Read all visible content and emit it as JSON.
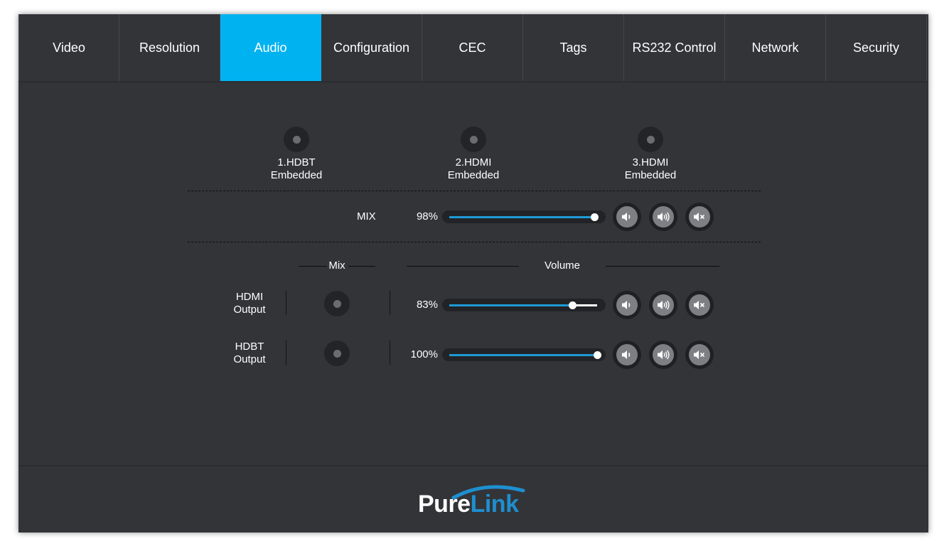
{
  "tabs": [
    {
      "label": "Video"
    },
    {
      "label": "Resolution"
    },
    {
      "label": "Audio"
    },
    {
      "label": "Configuration"
    },
    {
      "label": "CEC"
    },
    {
      "label": "Tags"
    },
    {
      "label": "RS232 Control"
    },
    {
      "label": "Network"
    },
    {
      "label": "Security"
    }
  ],
  "active_tab": "Audio",
  "accent_color": "#00b2f0",
  "sources": [
    {
      "label": "1.HDBT\nEmbedded"
    },
    {
      "label": "2.HDMI\nEmbedded"
    },
    {
      "label": "3.HDMI\nEmbedded"
    }
  ],
  "mix": {
    "label": "MIX",
    "value_text": "98%",
    "level": 0.98
  },
  "headers": {
    "mix": "Mix",
    "volume": "Volume"
  },
  "outputs": [
    {
      "label": "HDMI\nOutput",
      "value_text": "83%",
      "level": 0.83
    },
    {
      "label": "HDBT\nOutput",
      "value_text": "100%",
      "level": 1.0
    }
  ],
  "volume_buttons": [
    "volume-down-icon",
    "volume-up-icon",
    "mute-icon"
  ],
  "logo": {
    "part1": "Pure",
    "part2": "Link"
  }
}
